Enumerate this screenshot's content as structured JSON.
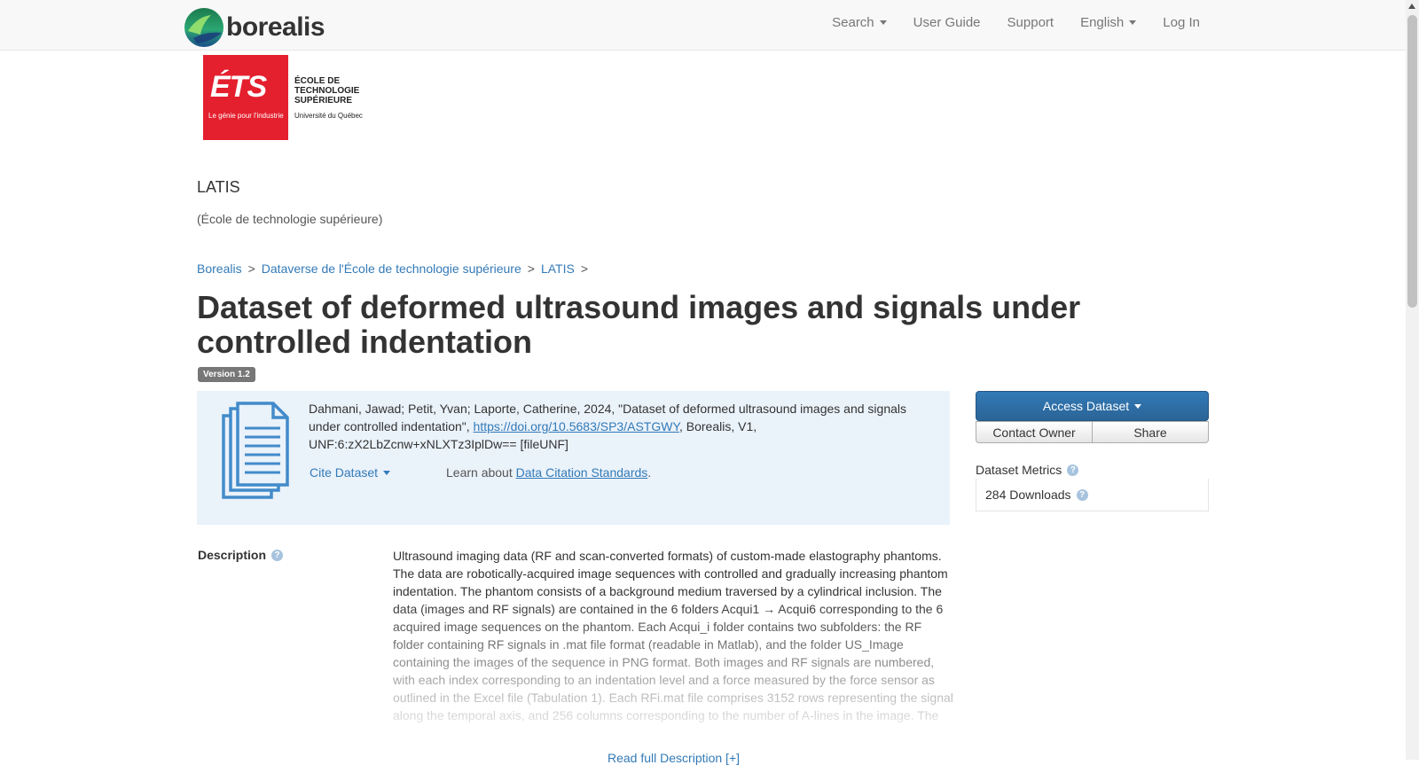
{
  "navbar": {
    "brand": "borealis",
    "links": {
      "search": "Search",
      "user_guide": "User Guide",
      "support": "Support",
      "language": "English",
      "login": "Log In"
    }
  },
  "institution_logo": {
    "mark": "ÉTS",
    "tagline": "Le génie pour l'industrie",
    "name_line1": "ÉCOLE DE",
    "name_line2": "TECHNOLOGIE",
    "name_line3": "SUPÉRIEURE",
    "subtitle": "Université du Québec",
    "color": "#e4202e"
  },
  "dataverse": {
    "name": "LATIS",
    "affiliation": "(École de technologie supérieure)"
  },
  "breadcrumb": [
    "Borealis",
    "Dataverse de l'École de technologie supérieure",
    "LATIS"
  ],
  "breadcrumb_sep": ">",
  "dataset": {
    "title": "Dataset of deformed ultrasound images and signals under controlled indentation",
    "version": "Version 1.2"
  },
  "citation": {
    "prefix": "Dahmani, Jawad; Petit, Yvan; Laporte, Catherine, 2024, \"Dataset of deformed ultrasound images and signals under controlled indentation\", ",
    "doi": "https://doi.org/10.5683/SP3/ASTGWY",
    "suffix": ", Borealis, V1, UNF:6:zX2LbZcnw+xNLXTz3IplDw== [fileUNF]",
    "cite_button": "Cite Dataset",
    "learn_prefix": "Learn about ",
    "learn_link": "Data Citation Standards",
    "learn_suffix": "."
  },
  "actions": {
    "access": "Access Dataset",
    "contact": "Contact Owner",
    "share": "Share"
  },
  "metrics": {
    "label": "Dataset Metrics",
    "downloads": "284 Downloads"
  },
  "description": {
    "label": "Description",
    "text": "Ultrasound imaging data (RF and scan-converted formats) of custom-made elastography phantoms. The data are robotically-acquired image sequences with controlled and gradually increasing phantom indentation. The phantom consists of a background medium traversed by a cylindrical inclusion. The data (images and RF signals) are contained in the 6 folders Acqui1 → Acqui6 corresponding to the 6 acquired image sequences on the phantom. Each Acqui_i folder contains two subfolders: the RF folder containing RF signals in .mat file format (readable in Matlab), and the folder US_Image containing the images of the sequence in PNG format. Both images and RF signals are numbered, with each index corresponding to an indentation level and a force measured by the force sensor as outlined in the Excel file (Tabulation 1). Each RFi.mat file comprises 3152 rows representing the signal along the temporal axis, and 256 columns corresponding to the number of A-lines in the image. The",
    "read_more": "Read full Description [+]"
  },
  "colors": {
    "link": "#337ab7",
    "primary_button": "#337ab7",
    "citation_bg": "#eaf2fa",
    "badge": "#777777"
  }
}
